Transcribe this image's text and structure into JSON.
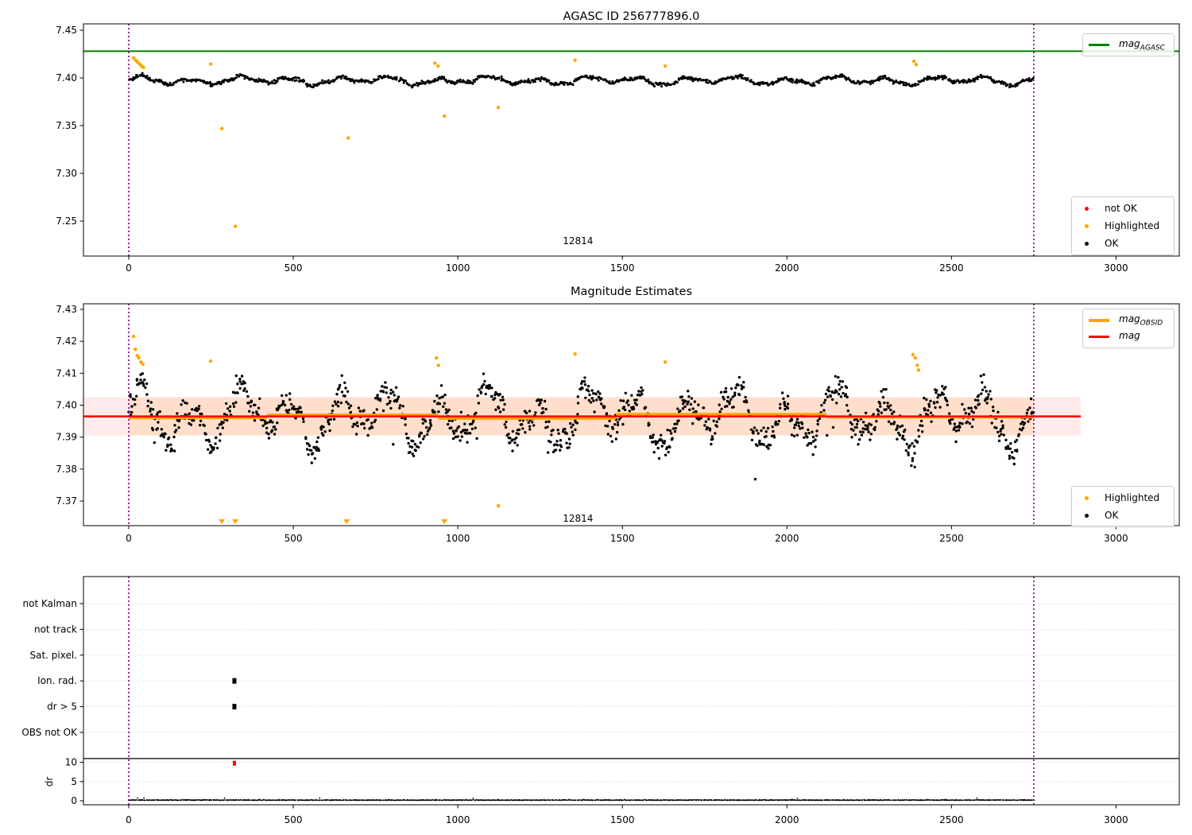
{
  "figure": {
    "background": "#ffffff"
  },
  "colors": {
    "ok_marker": "#000000",
    "highlighted_marker": "#ffa500",
    "not_ok_marker": "#ff0000",
    "mag_agasc_line": "#008000",
    "mag_line": "#ff0000",
    "mag_obsid_line": "#ffa500",
    "obsid_vline": "#8f008f",
    "band_red": "rgba(255,0,0,0.08)",
    "band_orange": "rgba(255,150,0,0.13)",
    "grid_dotted": "#c8c8c8"
  },
  "chart_data": [
    {
      "type": "scatter",
      "title": "AGASC ID 256777896.0",
      "x_ticks": [
        0,
        500,
        1000,
        1500,
        2000,
        2500,
        3000
      ],
      "y_ticks": [
        "7.45",
        "7.40",
        "7.35",
        "7.30",
        "7.25"
      ],
      "y_tick_values": [
        7.45,
        7.4,
        7.35,
        7.3,
        7.25
      ],
      "xlim": [
        -140,
        3195
      ],
      "ylim": [
        7.213,
        7.457
      ],
      "mag_agasc": 7.428,
      "vlines": [
        0,
        2750
      ],
      "annotation": {
        "text": "12814",
        "x": 1365
      },
      "ok_series": {
        "n": 1150,
        "x_range": [
          0,
          2750
        ],
        "mean": 7.3972,
        "noise": 0.0019,
        "wave": [
          [
            0.003,
            24,
            0
          ],
          [
            0.0017,
            57,
            1.3
          ],
          [
            0.0011,
            9.7,
            4
          ]
        ],
        "clip": [
          7.3845,
          7.4128
        ],
        "seed": 42
      },
      "highlighted": [
        [
          15,
          7.421
        ],
        [
          21,
          7.4185
        ],
        [
          27,
          7.4165
        ],
        [
          33,
          7.4145
        ],
        [
          39,
          7.4125
        ],
        [
          45,
          7.411
        ],
        [
          249,
          7.4145
        ],
        [
          283,
          7.347
        ],
        [
          324,
          7.2445
        ],
        [
          667,
          7.337
        ],
        [
          930,
          7.4155
        ],
        [
          940,
          7.4125
        ],
        [
          959,
          7.36
        ],
        [
          1123,
          7.369
        ],
        [
          1356,
          7.4185
        ],
        [
          1630,
          7.4125
        ],
        [
          2386,
          7.4175
        ],
        [
          2393,
          7.414
        ]
      ],
      "legend_line": {
        "label_main": "mag",
        "label_sub": "AGASC",
        "color": "#008000"
      },
      "legend_markers": [
        {
          "label": "not OK",
          "color": "#ff0000"
        },
        {
          "label": "Highlighted",
          "color": "#ffa500"
        },
        {
          "label": "OK",
          "color": "#000000"
        }
      ]
    },
    {
      "type": "scatter",
      "title": "Magnitude Estimates",
      "x_ticks": [
        0,
        500,
        1000,
        1500,
        2000,
        2500,
        3000
      ],
      "y_ticks": [
        "7.43",
        "7.42",
        "7.41",
        "7.40",
        "7.39",
        "7.38",
        "7.37"
      ],
      "y_tick_values": [
        7.43,
        7.42,
        7.41,
        7.4,
        7.39,
        7.38,
        7.37
      ],
      "xlim": [
        -140,
        3195
      ],
      "ylim": [
        7.362,
        7.432
      ],
      "mag": 7.3965,
      "mag_err": 0.006,
      "band": {
        "x_range": [
          -137,
          2893
        ],
        "low": 7.3905,
        "high": 7.4025
      },
      "obsid_band_range": [
        0,
        2750
      ],
      "obsid_segments": [
        {
          "x0": 0,
          "x1": 420,
          "mag": 7.396
        },
        {
          "x0": 420,
          "x1": 940,
          "mag": 7.397
        },
        {
          "x0": 940,
          "x1": 1480,
          "mag": 7.3958
        },
        {
          "x0": 1480,
          "x1": 2120,
          "mag": 7.3972
        },
        {
          "x0": 2120,
          "x1": 2750,
          "mag": 7.3962
        }
      ],
      "vlines": [
        0,
        2750
      ],
      "annotation": {
        "text": "12814",
        "x": 1365
      },
      "ok_series": {
        "n": 1250,
        "x_range": [
          0,
          2750
        ],
        "mean": 7.3962,
        "noise": 0.004,
        "wave": [
          [
            0.0063,
            24,
            0
          ],
          [
            0.0036,
            57,
            1.3
          ],
          [
            0.0023,
            9.7,
            4
          ]
        ],
        "clip": [
          7.366,
          7.4165
        ],
        "dip_prob": 0.012,
        "dip": 0.009,
        "seed": 1042
      },
      "highlighted": [
        [
          15,
          7.4215
        ],
        [
          20,
          7.4175
        ],
        [
          26,
          7.4155
        ],
        [
          31,
          7.4148
        ],
        [
          37,
          7.4135
        ],
        [
          43,
          7.4128
        ],
        [
          249,
          7.4138
        ],
        [
          935,
          7.4148
        ],
        [
          941,
          7.4125
        ],
        [
          1123,
          7.3685
        ],
        [
          1356,
          7.416
        ],
        [
          1630,
          7.4135
        ],
        [
          2383,
          7.4158
        ],
        [
          2390,
          7.4148
        ],
        [
          2396,
          7.4125
        ],
        [
          2400,
          7.411
        ]
      ],
      "clipped_low_x": [
        283,
        324,
        662,
        959
      ],
      "legend_lines": [
        {
          "label_main": "mag",
          "label_sub": "OBSID",
          "color": "#ffa500"
        },
        {
          "label_main": "mag",
          "label_sub": "",
          "color": "#ff0000"
        }
      ],
      "legend_markers": [
        {
          "label": "Highlighted",
          "color": "#ffa500"
        },
        {
          "label": "OK",
          "color": "#000000"
        }
      ]
    },
    {
      "type": "flags-dr",
      "flags": [
        "not Kalman",
        "not track",
        "Sat. pixel.",
        "Ion. rad.",
        "dr > 5",
        "OBS not OK"
      ],
      "dr_ticks": [
        "10",
        "5",
        "0"
      ],
      "dr_tick_values": [
        10,
        5,
        0
      ],
      "dr_label": "dr",
      "x_ticks": [
        0,
        500,
        1000,
        1500,
        2000,
        2500,
        3000
      ],
      "vlines": [
        0,
        2750
      ],
      "hline_dr": 11,
      "flag_points": [
        {
          "x": 321,
          "flag": "Ion. rad."
        },
        {
          "x": 321,
          "flag": "dr > 5"
        }
      ],
      "dr_not_ok": [
        {
          "x": 321,
          "dr": 10
        }
      ],
      "dr_series": {
        "n": 1300,
        "x_range": [
          0,
          2750
        ],
        "base": 0.12,
        "spread": 0.16,
        "spike_prob": 0.008,
        "spike": 0.45,
        "seed": 7
      }
    }
  ]
}
